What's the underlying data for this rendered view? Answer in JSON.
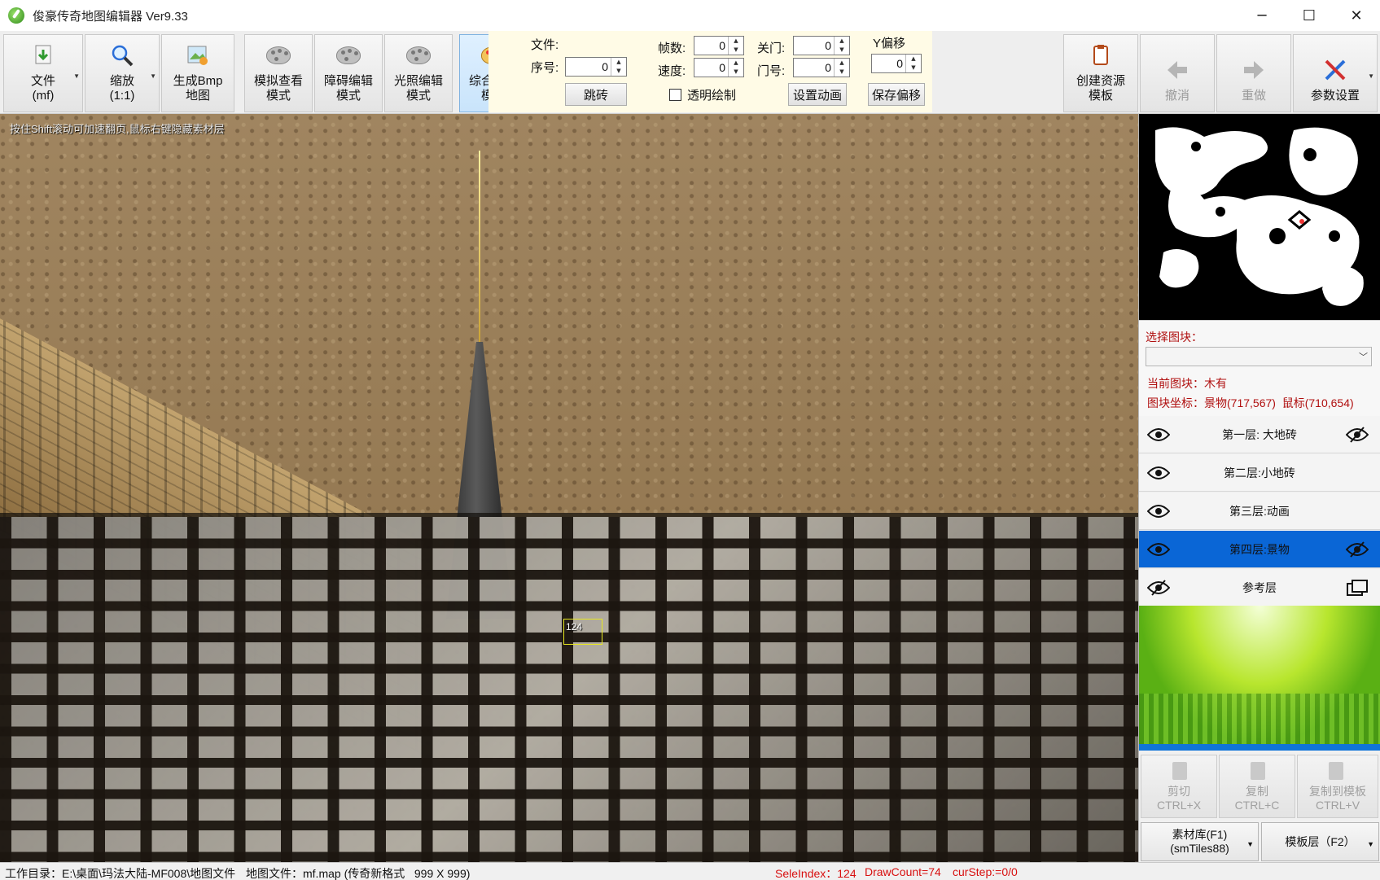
{
  "window": {
    "title": "俊豪传奇地图编辑器 Ver9.33",
    "minimize": "─",
    "maximize": "☐",
    "close": "✕"
  },
  "toolbar": {
    "file_label": "文件\n(mf)",
    "zoom_label": "缩放\n(1:1)",
    "bmp_label": "生成Bmp\n地图",
    "sim_label": "模拟查看\n模式",
    "obstacle_label": "障碍编辑\n模式",
    "light_label": "光照编辑\n模式",
    "combined_label": "综合编辑\n模式",
    "create_template_label": "创建资源\n模板",
    "undo_label": "撤消",
    "redo_label": "重做",
    "settings_label": "参数设置"
  },
  "props": {
    "file_label": "文件:",
    "index_label": "序号:",
    "index_value": "0",
    "jump_label": "跳砖",
    "frames_label": "帧数:",
    "frames_value": "0",
    "speed_label": "速度:",
    "speed_value": "0",
    "transparent_label": "透明绘制",
    "transparent_checked": false,
    "gate_label": "关门:",
    "gate_value": "0",
    "door_label": "门号:",
    "door_value": "0",
    "set_anim_label": "设置动画",
    "y_offset_label": "Y偏移",
    "y_offset_value": "0",
    "save_offset_label": "保存偏移"
  },
  "map": {
    "hint": "按住Shift滚动可加速翻页,鼠标右键隐藏素材层",
    "selected_tile_index": "124"
  },
  "right_panel": {
    "select_tile_label": "选择图块：",
    "current_tile_label": "当前图块：木有",
    "tile_coords_label": "图块坐标：景物(717,567)  鼠标(710,654)",
    "layers": [
      {
        "label": "第一层: 大地砖",
        "visible": true,
        "selected": false
      },
      {
        "label": "第二层:小地砖",
        "visible": true,
        "selected": false
      },
      {
        "label": "第三层:动画",
        "visible": true,
        "selected": false
      },
      {
        "label": "第四层:景物",
        "visible": true,
        "selected": true
      },
      {
        "label": "参考层",
        "visible": false,
        "selected": false
      }
    ],
    "cut_label": "剪切\nCTRL+X",
    "copy_label": "复制\nCTRL+C",
    "copy_template_label": "复制到模板\nCTRL+V",
    "library_label": "素材库(F1)\n(smTiles88)",
    "template_layer_label": "模板层（F2）"
  },
  "status": {
    "workdir": "工作目录：E:\\桌面\\玛法大陆-MF008\\地图文件",
    "mapfile": "地图文件：mf.map (传奇新格式   999 X 999)",
    "sele_index": "SeleIndex：124",
    "draw_count": "DrawCount=74",
    "cur_step": "curStep:=0/0"
  },
  "colors": {
    "accent": "#0a66d6",
    "status_red": "#d81010",
    "label_red": "#b01010"
  }
}
